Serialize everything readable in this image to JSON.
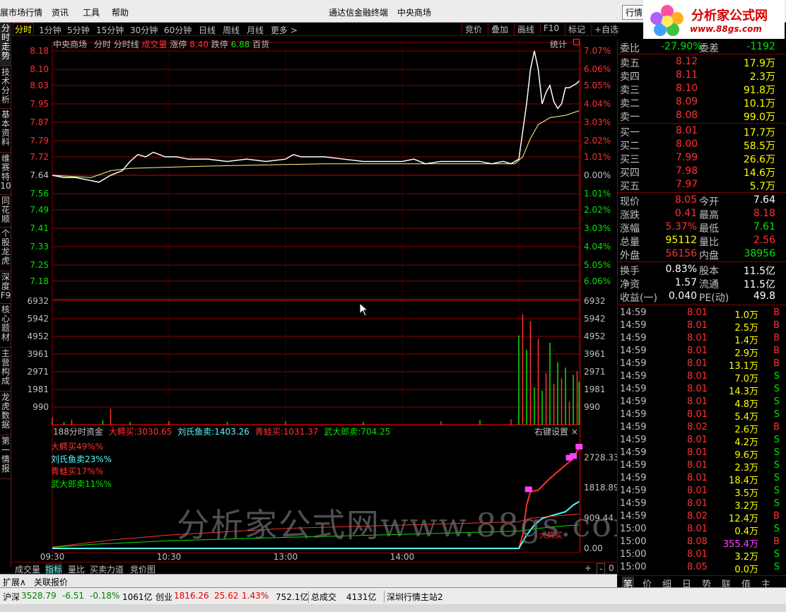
{
  "menubar": {
    "items": [
      "展市场行情",
      "资讯",
      "工具",
      "帮助"
    ],
    "center": [
      "通达信金融终端",
      "中央商场"
    ],
    "right_label": "行情"
  },
  "logo": {
    "text": "分析家公式网",
    "url": "www.88gs.com"
  },
  "left_tabs": [
    "分时走势",
    "技术分析",
    "基本资料",
    "维赛特10",
    "同花顺",
    "个股龙虎",
    "深度F9",
    "核心题材",
    "主营构成",
    "龙虎数据",
    "第一情报"
  ],
  "toolbar": {
    "tabs": [
      "分时",
      "1分钟",
      "5分钟",
      "15分钟",
      "30分钟",
      "60分钟",
      "日线",
      "周线",
      "月线",
      "更多 >"
    ],
    "right": [
      "竞价",
      "叠加",
      "画线",
      "F10",
      "标记",
      "+自选"
    ]
  },
  "chart_header": {
    "name": "中央商场",
    "items": [
      "分时",
      "分时线",
      "成交量",
      "涨停",
      "8.40",
      "跌停",
      "6.88",
      "百货"
    ],
    "stats": "统计"
  },
  "flow_header": {
    "title": "188分时资金",
    "items": [
      {
        "label": "大鳄买:",
        "value": "3030.65",
        "color": "#ff3232"
      },
      {
        "label": "刘氏鱼卖:",
        "value": "1403.26",
        "color": "#54ffff"
      },
      {
        "label": "青蛙买:",
        "value": "1031.37",
        "color": "#ff3232"
      },
      {
        "label": "武大郎卖:",
        "value": "704.25",
        "color": "#00e600"
      }
    ],
    "settings": "右键设置 ×",
    "legend": [
      {
        "text": "大鳄买49%%",
        "color": "#ff3232"
      },
      {
        "text": "刘氏鱼卖23%%",
        "color": "#54ffff"
      },
      {
        "text": "青蛙买17%%",
        "color": "#ff3232"
      },
      {
        "text": "武大郎卖11%%",
        "color": "#00e600"
      }
    ],
    "annotation": "大鳄买"
  },
  "bottom_tabs": [
    "成交量",
    "指标",
    "量比",
    "买卖力道",
    "竞价图"
  ],
  "bottom_controls": [
    "+",
    "-",
    "0"
  ],
  "ext_bar": [
    "扩展∧",
    "关联报价"
  ],
  "right_panel": {
    "weibi": {
      "label": "委比",
      "value": "-27.90%",
      "label2": "委差",
      "value2": "-1192"
    },
    "sells": [
      {
        "label": "卖五",
        "price": "8.12",
        "vol": "17.9万"
      },
      {
        "label": "卖四",
        "price": "8.11",
        "vol": "2.3万"
      },
      {
        "label": "卖三",
        "price": "8.10",
        "vol": "91.8万"
      },
      {
        "label": "卖二",
        "price": "8.09",
        "vol": "10.1万"
      },
      {
        "label": "卖一",
        "price": "8.08",
        "vol": "99.0万"
      }
    ],
    "buys": [
      {
        "label": "买一",
        "price": "8.01",
        "vol": "17.7万"
      },
      {
        "label": "买二",
        "price": "8.00",
        "vol": "58.5万"
      },
      {
        "label": "买三",
        "price": "7.99",
        "vol": "26.6万"
      },
      {
        "label": "买四",
        "price": "7.98",
        "vol": "14.6万"
      },
      {
        "label": "买五",
        "price": "7.97",
        "vol": "5.7万"
      }
    ],
    "quote": [
      {
        "l1": "现价",
        "v1": "8.05",
        "c1": "#ff3232",
        "l2": "今开",
        "v2": "7.64",
        "c2": "#ffffff"
      },
      {
        "l1": "涨跌",
        "v1": "0.41",
        "c1": "#ff3232",
        "l2": "最高",
        "v2": "8.18",
        "c2": "#ff3232"
      },
      {
        "l1": "涨幅",
        "v1": "5.37%",
        "c1": "#ff3232",
        "l2": "最低",
        "v2": "7.61",
        "c2": "#00e600"
      },
      {
        "l1": "总量",
        "v1": "95112",
        "c1": "#ffff00",
        "l2": "量比",
        "v2": "2.56",
        "c2": "#ff3232"
      },
      {
        "l1": "外盘",
        "v1": "56156",
        "c1": "#ff3232",
        "l2": "内盘",
        "v2": "38956",
        "c2": "#00e600"
      }
    ],
    "finance": [
      {
        "l1": "换手",
        "v1": "0.83%",
        "l2": "股本",
        "v2": "11.5亿"
      },
      {
        "l1": "净资",
        "v1": "1.57",
        "l2": "流通",
        "v2": "11.5亿"
      },
      {
        "l1": "收益(一)",
        "v1": "0.040",
        "l2": "PE(动)",
        "v2": "49.8"
      }
    ],
    "ticks": [
      {
        "t": "14:59",
        "p": "8.01",
        "v": "1.0万",
        "d": "B"
      },
      {
        "t": "14:59",
        "p": "8.01",
        "v": "2.5万",
        "d": "B"
      },
      {
        "t": "14:59",
        "p": "8.01",
        "v": "1.4万",
        "d": "B"
      },
      {
        "t": "14:59",
        "p": "8.01",
        "v": "2.9万",
        "d": "B"
      },
      {
        "t": "14:59",
        "p": "8.01",
        "v": "13.1万",
        "d": "B"
      },
      {
        "t": "14:59",
        "p": "8.01",
        "v": "7.0万",
        "d": "S"
      },
      {
        "t": "14:59",
        "p": "8.01",
        "v": "14.3万",
        "d": "S"
      },
      {
        "t": "14:59",
        "p": "8.01",
        "v": "4.8万",
        "d": "S"
      },
      {
        "t": "14:59",
        "p": "8.01",
        "v": "5.4万",
        "d": "S"
      },
      {
        "t": "14:59",
        "p": "8.02",
        "v": "2.6万",
        "d": "B"
      },
      {
        "t": "14:59",
        "p": "8.01",
        "v": "4.2万",
        "d": "S"
      },
      {
        "t": "14:59",
        "p": "8.01",
        "v": "9.6万",
        "d": "S"
      },
      {
        "t": "14:59",
        "p": "8.01",
        "v": "2.3万",
        "d": "S"
      },
      {
        "t": "14:59",
        "p": "8.01",
        "v": "18.4万",
        "d": "S"
      },
      {
        "t": "14:59",
        "p": "8.01",
        "v": "3.5万",
        "d": "S"
      },
      {
        "t": "14:59",
        "p": "8.01",
        "v": "3.2万",
        "d": "S"
      },
      {
        "t": "14:59",
        "p": "8.02",
        "v": "12.4万",
        "d": "B"
      },
      {
        "t": "15:00",
        "p": "8.01",
        "v": "0.4万",
        "d": "S"
      },
      {
        "t": "15:00",
        "p": "8.08",
        "v": "355.4万",
        "d": "B"
      },
      {
        "t": "15:00",
        "p": "8.01",
        "v": "3.2万",
        "d": "S"
      },
      {
        "t": "15:00",
        "p": "8.05",
        "v": "0.0万",
        "d": "S"
      }
    ],
    "tabs": [
      "笔",
      "价",
      "细",
      "日",
      "势",
      "联",
      "值",
      "主"
    ]
  },
  "status_bar": {
    "sh_label": "沪深",
    "sh_index": "3528.79",
    "sh_chg": "-6.51",
    "sh_pct": "-0.18%",
    "sh_amt": "1061亿",
    "cy_label": "创业",
    "cy_index": "1816.26",
    "cy_chg": "25.62",
    "cy_pct": "1.43%",
    "cy_amt": "752.1亿",
    "total_label": "总成交",
    "total_amt": "4131亿",
    "server": "深圳行情主站2"
  },
  "watermark": "分析家公式网www.88gs.com",
  "colors": {
    "up": "#ff3232",
    "down": "#00e600",
    "grid": "#8b0000",
    "price_line": "#ffffff",
    "avg_line": "#ffff80"
  },
  "chart_data": {
    "type": "line",
    "price_axis": {
      "ticks_left": [
        "8.18",
        "8.10",
        "8.03",
        "7.95",
        "7.87",
        "7.79",
        "7.72",
        "7.64",
        "7.56",
        "7.49",
        "7.41",
        "7.33",
        "7.25",
        "7.18"
      ],
      "ticks_right": [
        "7.07%",
        "6.06%",
        "5.05%",
        "4.04%",
        "3.03%",
        "2.02%",
        "1.01%",
        "0.00%",
        "1.01%",
        "2.02%",
        "3.03%",
        "4.04%",
        "5.05%",
        "6.06%"
      ],
      "ylim": [
        7.1,
        8.18
      ],
      "prev_close": 7.64
    },
    "volume_axis": {
      "ticks": [
        "6932",
        "5942",
        "4952",
        "3961",
        "2971",
        "1981",
        "990"
      ],
      "ylim": [
        0,
        6932
      ]
    },
    "flow_axis": {
      "ticks": [
        "2728.33",
        "1818.89",
        "909.44",
        "0.00"
      ],
      "ylim": [
        0,
        3200
      ]
    },
    "x_ticks": [
      "09:30",
      "10:30",
      "13:00",
      "14:00"
    ],
    "price_series": [
      [
        0,
        7.64
      ],
      [
        6,
        7.63
      ],
      [
        12,
        7.63
      ],
      [
        18,
        7.62
      ],
      [
        24,
        7.61
      ],
      [
        30,
        7.64
      ],
      [
        36,
        7.66
      ],
      [
        40,
        7.7
      ],
      [
        44,
        7.73
      ],
      [
        48,
        7.72
      ],
      [
        52,
        7.74
      ],
      [
        58,
        7.72
      ],
      [
        64,
        7.72
      ],
      [
        70,
        7.71
      ],
      [
        80,
        7.71
      ],
      [
        90,
        7.7
      ],
      [
        100,
        7.71
      ],
      [
        110,
        7.7
      ],
      [
        120,
        7.71
      ],
      [
        124,
        7.73
      ],
      [
        128,
        7.72
      ],
      [
        134,
        7.72
      ],
      [
        140,
        7.72
      ],
      [
        150,
        7.71
      ],
      [
        160,
        7.7
      ],
      [
        170,
        7.7
      ],
      [
        180,
        7.7
      ],
      [
        186,
        7.71
      ],
      [
        192,
        7.69
      ],
      [
        200,
        7.7
      ],
      [
        210,
        7.7
      ],
      [
        220,
        7.7
      ],
      [
        226,
        7.69
      ],
      [
        232,
        7.7
      ],
      [
        236,
        7.69
      ],
      [
        240,
        7.71
      ],
      [
        244,
        7.95
      ],
      [
        246,
        8.1
      ],
      [
        248,
        8.18
      ],
      [
        250,
        8.1
      ],
      [
        252,
        7.95
      ],
      [
        254,
        8.0
      ],
      [
        256,
        8.03
      ],
      [
        258,
        7.96
      ],
      [
        260,
        7.93
      ],
      [
        262,
        7.95
      ],
      [
        264,
        8.02
      ],
      [
        266,
        8.02
      ],
      [
        268,
        8.03
      ],
      [
        270,
        8.04
      ],
      [
        271,
        8.05
      ]
    ],
    "avg_series": [
      [
        0,
        7.64
      ],
      [
        20,
        7.63
      ],
      [
        30,
        7.66
      ],
      [
        40,
        7.67
      ],
      [
        80,
        7.68
      ],
      [
        140,
        7.69
      ],
      [
        200,
        7.69
      ],
      [
        238,
        7.69
      ],
      [
        242,
        7.72
      ],
      [
        246,
        7.8
      ],
      [
        250,
        7.86
      ],
      [
        256,
        7.89
      ],
      [
        264,
        7.9
      ],
      [
        271,
        7.92
      ]
    ],
    "volume_series": [
      [
        0,
        400
      ],
      [
        6,
        150
      ],
      [
        10,
        300
      ],
      [
        26,
        250
      ],
      [
        30,
        900
      ],
      [
        40,
        150
      ],
      [
        60,
        200
      ],
      [
        90,
        150
      ],
      [
        120,
        200
      ],
      [
        160,
        150
      ],
      [
        200,
        200
      ],
      [
        220,
        250
      ],
      [
        236,
        300
      ],
      [
        240,
        5000
      ],
      [
        242,
        6200
      ],
      [
        244,
        4200
      ],
      [
        246,
        5800
      ],
      [
        248,
        2100
      ],
      [
        250,
        4800
      ],
      [
        252,
        1900
      ],
      [
        254,
        2900
      ],
      [
        256,
        4600
      ],
      [
        258,
        2300
      ],
      [
        260,
        3500
      ],
      [
        262,
        2600
      ],
      [
        264,
        3200
      ],
      [
        266,
        1300
      ],
      [
        268,
        2800
      ],
      [
        270,
        3000
      ],
      [
        271,
        2400
      ]
    ],
    "flow_series": [
      {
        "name": "大鳄买",
        "values": [
          [
            0,
            0
          ],
          [
            60,
            0
          ],
          [
            120,
            0
          ],
          [
            240,
            0
          ],
          [
            242,
            400
          ],
          [
            244,
            1300
          ],
          [
            246,
            1700
          ],
          [
            250,
            1750
          ],
          [
            256,
            2100
          ],
          [
            262,
            2400
          ],
          [
            268,
            2700
          ],
          [
            271,
            3030
          ]
        ]
      },
      {
        "name": "刘氏鱼卖",
        "values": [
          [
            0,
            0
          ],
          [
            120,
            0
          ],
          [
            240,
            0
          ],
          [
            244,
            400
          ],
          [
            248,
            700
          ],
          [
            252,
            900
          ],
          [
            258,
            1000
          ],
          [
            264,
            1100
          ],
          [
            268,
            1300
          ],
          [
            271,
            1403
          ]
        ]
      },
      {
        "name": "青蛙买",
        "values": [
          [
            0,
            40
          ],
          [
            30,
            250
          ],
          [
            60,
            400
          ],
          [
            120,
            600
          ],
          [
            180,
            700
          ],
          [
            240,
            800
          ],
          [
            246,
            900
          ],
          [
            256,
            960
          ],
          [
            271,
            1031
          ]
        ]
      },
      {
        "name": "武大郎卖",
        "values": [
          [
            0,
            30
          ],
          [
            20,
            120
          ],
          [
            60,
            230
          ],
          [
            120,
            330
          ],
          [
            180,
            420
          ],
          [
            240,
            520
          ],
          [
            250,
            600
          ],
          [
            260,
            660
          ],
          [
            271,
            704
          ]
        ]
      }
    ]
  }
}
